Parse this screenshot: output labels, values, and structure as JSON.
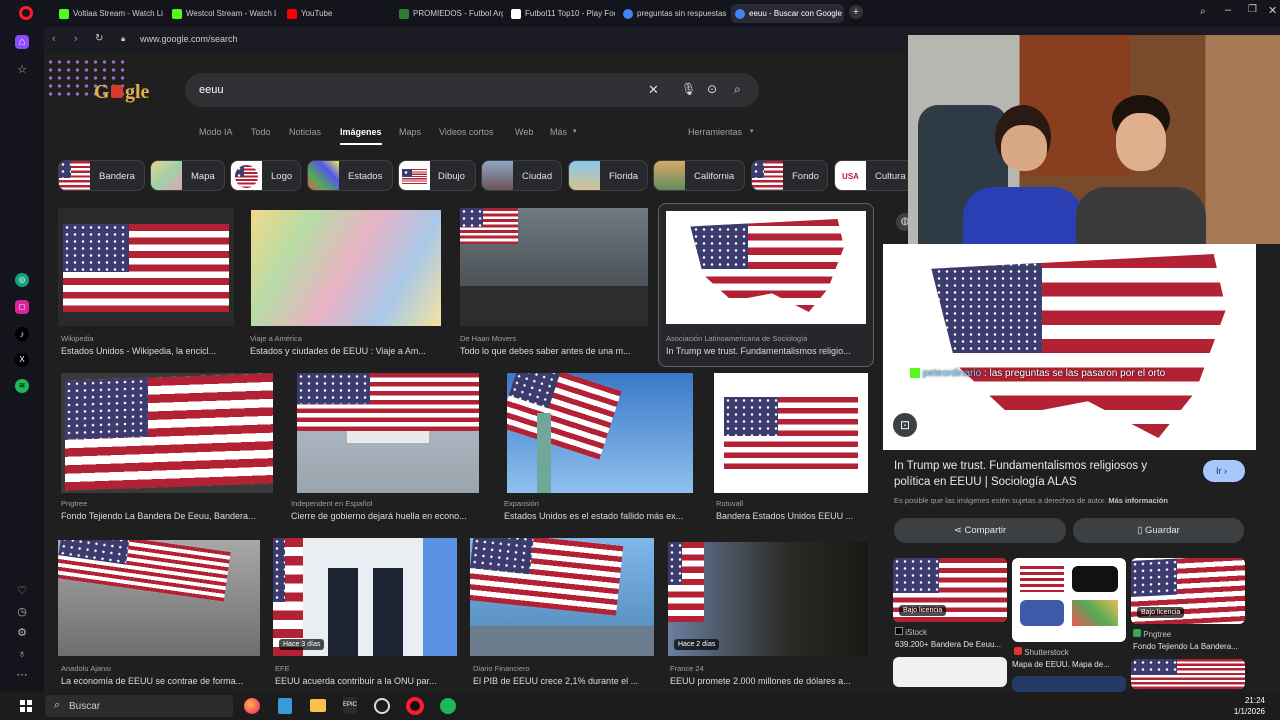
{
  "browser": {
    "tabs": [
      {
        "label": "Voltiaa Stream - Watch Li",
        "color": "#53fc18"
      },
      {
        "label": "Westcol Stream - Watch L",
        "color": "#53fc18"
      },
      {
        "label": "YouTube",
        "color": "#ff0000"
      },
      {
        "label": "PROMIEDOS - Futbol Arg",
        "color": "#2e7d32"
      },
      {
        "label": "Futbol11 Top10 - Play Foo",
        "color": "#ffffff"
      },
      {
        "label": "preguntas sin respuestas",
        "color": "#4285f4"
      },
      {
        "label": "eeuu - Buscar con Google",
        "color": "#4285f4"
      }
    ],
    "url": "www.google.com/search"
  },
  "search": {
    "query": "eeuu"
  },
  "nav_tabs": [
    "Modo IA",
    "Todo",
    "Noticias",
    "Imágenes",
    "Maps",
    "Videos cortos",
    "Web",
    "Más",
    "Herramientas"
  ],
  "chips": [
    "Bandera",
    "Mapa",
    "Logo",
    "Estados",
    "Dibujo",
    "Ciudad",
    "Florida",
    "California",
    "Fondo",
    "Cultura"
  ],
  "results": [
    {
      "source": "Wikipedia",
      "title": "Estados Unidos - Wikipedia, la encicl..."
    },
    {
      "source": "Viaje a América",
      "title": "Estados y ciudades de EEUU : Viaje a Am..."
    },
    {
      "source": "De Haan Movers",
      "title": "Todo lo que debes saber antes de una m..."
    },
    {
      "source": "Asociación Latinoamericana de Sociología",
      "title": "In Trump we trust. Fundamentalismos religio..."
    },
    {
      "source": "Pngtree",
      "title": "Fondo Tejiendo La Bandera De Eeuu, Bandera..."
    },
    {
      "source": "Independent en Español",
      "title": "Cierre de gobierno dejará huella en econo..."
    },
    {
      "source": "Expansión",
      "title": "Estados Unidos es el estado fallido más ex..."
    },
    {
      "source": "Rotuvall",
      "title": "Bandera Estados Unidos EEUU ..."
    },
    {
      "source": "Anadolu Ajansı",
      "title": "La economía de EEUU se contrae de forma..."
    },
    {
      "source": "EFE",
      "title": "EEUU acuerda contribuir a la ONU par...",
      "badge": "Hace 3 días"
    },
    {
      "source": "Diario Financiero",
      "title": "El PIB de EEUU crece 2,1% durante el ..."
    },
    {
      "source": "France 24",
      "title": "EEUU promete 2.000 millones de dólares a...",
      "badge": "Hace 2 días"
    }
  ],
  "panel": {
    "overlay_user": "peteordinario",
    "overlay_text": "las preguntas se las pasaron por el orto",
    "title": "In Trump we trust. Fundamentalismos religiosos y política en EEUU | Sociología ALAS",
    "visit": "Ir",
    "notice": "Es posible que las imágenes estén sujetas a derechos de autor.",
    "more_info": "Más información",
    "share": "Compartir",
    "save": "Guardar",
    "related": [
      {
        "badge": "Bajo licencia",
        "source": "iStock",
        "title": "639.200+ Bandera De Eeuu..."
      },
      {
        "source": "Shutterstock",
        "title": "Mapa de EEUU. Mapa de..."
      },
      {
        "badge": "Bajo licencia",
        "source": "Pngtree",
        "title": "Fondo Tejiendo La Bandera..."
      }
    ]
  },
  "taskbar": {
    "search": "Buscar",
    "time": "21:24",
    "date": "1/1/2026"
  }
}
